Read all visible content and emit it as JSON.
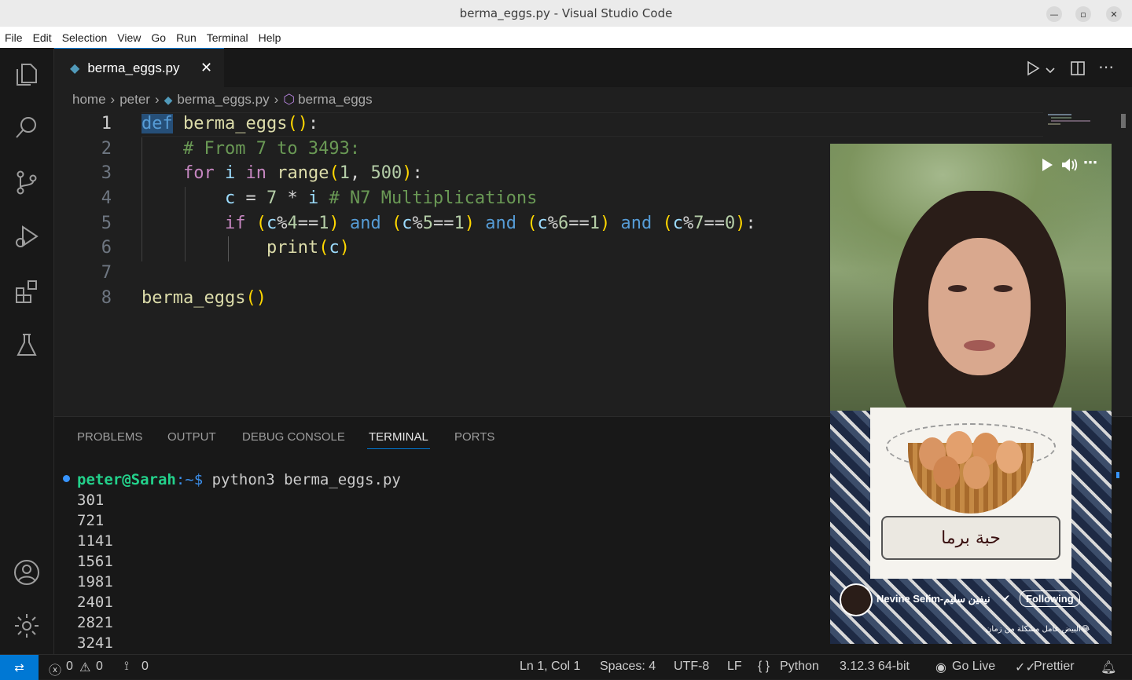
{
  "window": {
    "title": "berma_eggs.py - Visual Studio Code"
  },
  "menu": [
    "File",
    "Edit",
    "Selection",
    "View",
    "Go",
    "Run",
    "Terminal",
    "Help"
  ],
  "tab": {
    "label": "berma_eggs.py"
  },
  "breadcrumb": {
    "p1": "home",
    "p2": "peter",
    "p3": "berma_eggs.py",
    "p4": "berma_eggs"
  },
  "editor": {
    "line_numbers": [
      "1",
      "2",
      "3",
      "4",
      "5",
      "6",
      "7",
      "8"
    ],
    "lines": [
      "def berma_eggs():",
      "    # From 7 to 3493:",
      "    for i in range(1, 500):",
      "        c = 7 * i # N7 Multiplications",
      "        if (c%4==1) and (c%5==1) and (c%6==1) and (c%7==0):",
      "            print(c)",
      "",
      "berma_eggs()"
    ]
  },
  "panel": {
    "tabs": [
      "PROBLEMS",
      "OUTPUT",
      "DEBUG CONSOLE",
      "TERMINAL",
      "PORTS"
    ],
    "active_tab": "TERMINAL",
    "prompt_user": "peter@Sarah",
    "prompt_path": ":~$ ",
    "command": "python3 berma_eggs.py",
    "output": [
      "301",
      "721",
      "1141",
      "1561",
      "1981",
      "2401",
      "2821",
      "3241"
    ]
  },
  "video": {
    "card_text": "حبة برما",
    "author": "Nevine Selim-نيفين سليم",
    "follow_label": "Following",
    "caption": "البيض عامل مشكلة من زمان😂"
  },
  "status": {
    "errors": "0",
    "warnings": "0",
    "ports": "0",
    "position": "Ln 1, Col 1",
    "spaces": "Spaces: 4",
    "encoding": "UTF-8",
    "eol": "LF",
    "language": "Python",
    "interpreter": "3.12.3 64-bit",
    "golive": "Go Live",
    "prettier": "Prettier"
  },
  "colors": {
    "accent": "#0078d4",
    "editor_bg": "#1f1f1f",
    "sidebar_bg": "#181818",
    "prompt_green": "#23d18b"
  }
}
